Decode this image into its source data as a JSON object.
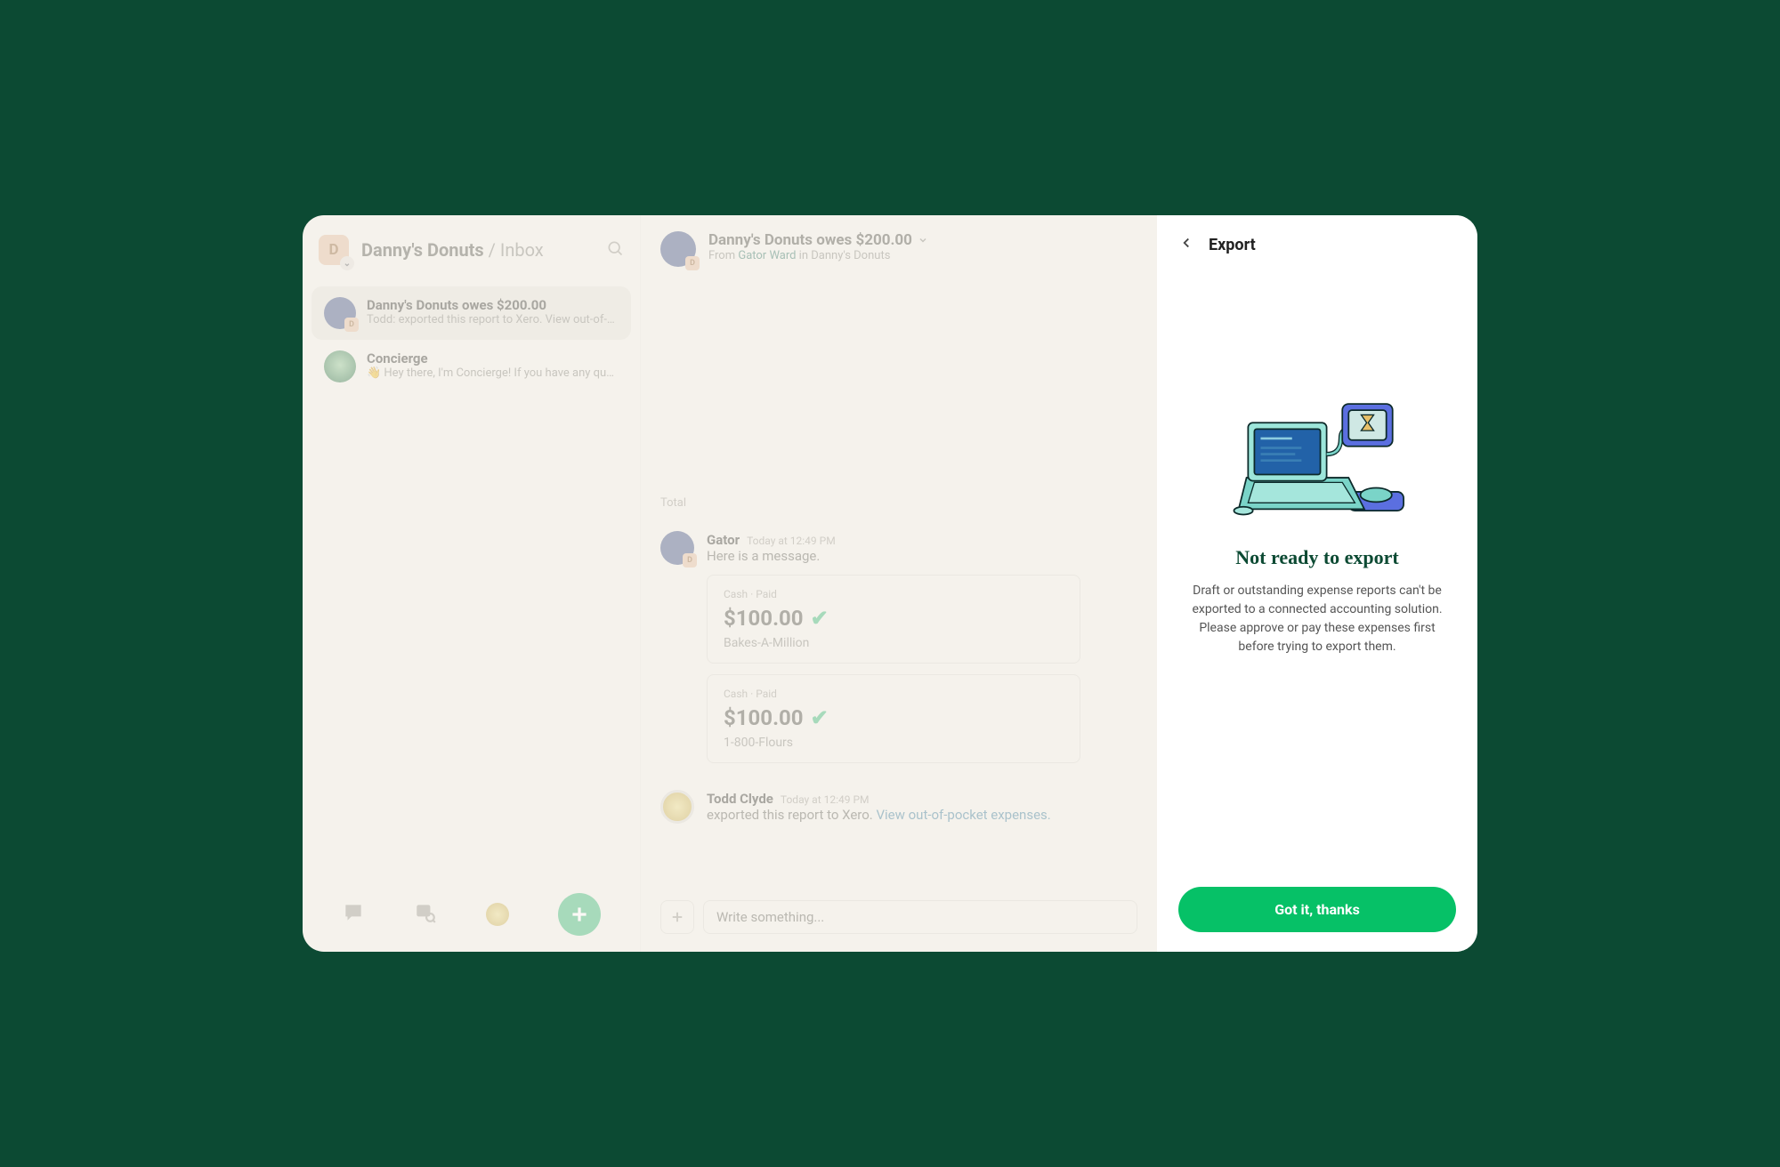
{
  "sidebar": {
    "avatar_letter": "D",
    "title": "Danny's Donuts",
    "subtitle": "Inbox",
    "conversations": [
      {
        "title": "Danny's Donuts owes $200.00",
        "preview": "Todd: exported this report to Xero. View out-of-p...",
        "mini_badge": "D",
        "active": true,
        "avatar": "user"
      },
      {
        "title": "Concierge",
        "preview": "👋 Hey there, I'm Concierge! If you have any que...",
        "mini_badge": "",
        "active": false,
        "avatar": "concierge"
      }
    ]
  },
  "main": {
    "header_title": "Danny's Donuts owes $200.00",
    "header_from_prefix": "From ",
    "header_from_link": "Gator Ward",
    "header_from_suffix": " in Danny's Donuts",
    "header_mini_badge": "D",
    "total_label": "Total",
    "messages": [
      {
        "author": "Gator",
        "timestamp": "Today at 12:49 PM",
        "text": "Here is a message.",
        "avatar": "gator",
        "mini_badge": "D",
        "expenses": [
          {
            "meta": "Cash · Paid",
            "amount": "$100.00",
            "merchant": "Bakes-A-Million"
          },
          {
            "meta": "Cash · Paid",
            "amount": "$100.00",
            "merchant": "1-800-Flours"
          }
        ]
      },
      {
        "author": "Todd Clyde",
        "timestamp": "Today at 12:49 PM",
        "text_plain": "exported this report to Xero. ",
        "text_link": "View out-of-pocket expenses.",
        "avatar": "todd"
      }
    ],
    "composer_placeholder": "Write something..."
  },
  "drawer": {
    "title": "Export",
    "heading": "Not ready to export",
    "paragraph": "Draft or outstanding expense reports can't be exported to a connected accounting solution. Please approve or pay these expenses first before trying to export them.",
    "button": "Got it, thanks"
  }
}
